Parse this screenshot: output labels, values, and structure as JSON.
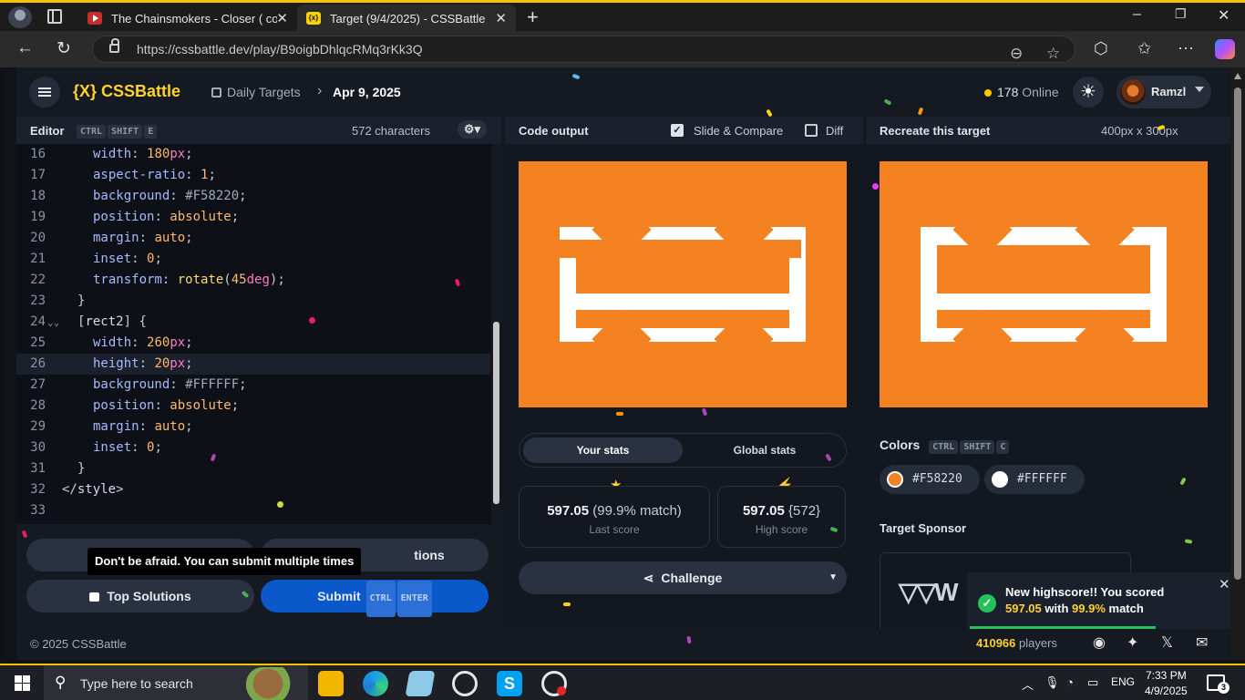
{
  "browser": {
    "tabs": [
      {
        "title": "The Chainsmokers - Closer ( cover"
      },
      {
        "title": "Target (9/4/2025) - CSSBattle",
        "favicon_text": "{x}"
      }
    ],
    "url": "https://cssbattle.dev/play/B9oigbDhlqcRMq3rKk3Q",
    "new_tab_symbol": "+",
    "window_controls": [
      "–",
      "❐",
      "✕"
    ]
  },
  "header": {
    "logo_mark": "{X}",
    "logo_text": "CSSBattle",
    "crumb_section": "Daily Targets",
    "crumb_separator": "›",
    "crumb_date": "Apr 9, 2025",
    "online_count": "178",
    "online_label": "Online",
    "user_name": "Ramzl"
  },
  "editor": {
    "title": "Editor",
    "shortcut": [
      "CTRL",
      "SHIFT",
      "E"
    ],
    "char_count": "572 characters",
    "lines": [
      {
        "n": "16",
        "tokens": [
          [
            "prop",
            "width"
          ],
          [
            "p",
            ": "
          ],
          [
            "num",
            "180"
          ],
          [
            "unit",
            "px"
          ],
          [
            "p",
            ";"
          ]
        ]
      },
      {
        "n": "17",
        "tokens": [
          [
            "prop",
            "aspect-ratio"
          ],
          [
            "p",
            ": "
          ],
          [
            "num",
            "1"
          ],
          [
            "p",
            ";"
          ]
        ]
      },
      {
        "n": "18",
        "tokens": [
          [
            "prop",
            "background"
          ],
          [
            "p",
            ": "
          ],
          [
            "hex",
            "#F58220"
          ],
          [
            "p",
            ";"
          ]
        ]
      },
      {
        "n": "19",
        "tokens": [
          [
            "prop",
            "position"
          ],
          [
            "p",
            ": "
          ],
          [
            "num",
            "absolute"
          ],
          [
            "p",
            ";"
          ]
        ]
      },
      {
        "n": "20",
        "tokens": [
          [
            "prop",
            "margin"
          ],
          [
            "p",
            ": "
          ],
          [
            "num",
            "auto"
          ],
          [
            "p",
            ";"
          ]
        ]
      },
      {
        "n": "21",
        "tokens": [
          [
            "prop",
            "inset"
          ],
          [
            "p",
            ": "
          ],
          [
            "num",
            "0"
          ],
          [
            "p",
            ";"
          ]
        ]
      },
      {
        "n": "22",
        "tokens": [
          [
            "prop",
            "transform"
          ],
          [
            "p",
            ": "
          ],
          [
            "fn",
            "rotate"
          ],
          [
            "p",
            "("
          ],
          [
            "num",
            "45"
          ],
          [
            "unit",
            "deg"
          ],
          [
            "p",
            ");"
          ]
        ]
      },
      {
        "n": "23",
        "tokens": [
          [
            "p",
            "}"
          ]
        ],
        "indent": 1
      },
      {
        "n": "24",
        "tokens": [
          [
            "p",
            "["
          ],
          [
            "tag",
            "rect2"
          ],
          [
            "p",
            "] {"
          ]
        ],
        "indent": 1,
        "fold": "⌄⌄"
      },
      {
        "n": "25",
        "tokens": [
          [
            "prop",
            "width"
          ],
          [
            "p",
            ": "
          ],
          [
            "num",
            "260"
          ],
          [
            "unit",
            "px"
          ],
          [
            "p",
            ";"
          ]
        ]
      },
      {
        "n": "26",
        "tokens": [
          [
            "prop",
            "height"
          ],
          [
            "p",
            ": "
          ],
          [
            "num",
            "20"
          ],
          [
            "unit",
            "px"
          ],
          [
            "p",
            ";"
          ]
        ],
        "active": true
      },
      {
        "n": "27",
        "tokens": [
          [
            "prop",
            "background"
          ],
          [
            "p",
            ": "
          ],
          [
            "hex",
            "#FFFFFF"
          ],
          [
            "p",
            ";"
          ]
        ]
      },
      {
        "n": "28",
        "tokens": [
          [
            "prop",
            "position"
          ],
          [
            "p",
            ": "
          ],
          [
            "num",
            "absolute"
          ],
          [
            "p",
            ";"
          ]
        ]
      },
      {
        "n": "29",
        "tokens": [
          [
            "prop",
            "margin"
          ],
          [
            "p",
            ": "
          ],
          [
            "num",
            "auto"
          ],
          [
            "p",
            ";"
          ]
        ]
      },
      {
        "n": "30",
        "tokens": [
          [
            "prop",
            "inset"
          ],
          [
            "p",
            ": "
          ],
          [
            "num",
            "0"
          ],
          [
            "p",
            ";"
          ]
        ]
      },
      {
        "n": "31",
        "tokens": [
          [
            "p",
            "}"
          ]
        ],
        "indent": 1
      },
      {
        "n": "32",
        "tokens": [
          [
            "p",
            "</"
          ],
          [
            "tag",
            "style"
          ],
          [
            "p",
            ">"
          ]
        ],
        "indent": 0
      },
      {
        "n": "33",
        "tokens": [],
        "indent": 0
      }
    ],
    "tooltip": "Don't be afraid. You can submit multiple times",
    "solutions_btn_tail": "tions",
    "top_solutions": "Top Solutions",
    "submit": "Submit",
    "submit_keys": [
      "CTRL",
      "ENTER"
    ]
  },
  "output": {
    "title": "Code output",
    "slide_compare": "Slide & Compare",
    "slide_compare_checked": true,
    "diff": "Diff",
    "diff_checked": false,
    "tab_your": "Your stats",
    "tab_global": "Global stats",
    "last_score": "597.05",
    "last_match": "(99.9% match)",
    "last_label": "Last score",
    "high_score": "597.05",
    "high_chars": "{572}",
    "high_label": "High score",
    "challenge": "Challenge"
  },
  "target": {
    "title": "Recreate this target",
    "size": "400px x 300px",
    "colors_label": "Colors",
    "colors_keys": [
      "CTRL",
      "SHIFT",
      "C"
    ],
    "colors": [
      {
        "hex": "#F58220",
        "swatch": "#f58220"
      },
      {
        "hex": "#FFFFFF",
        "swatch": "#ffffff"
      }
    ],
    "sponsor_label": "Target Sponsor",
    "sponsor_logo": "W"
  },
  "toast": {
    "line1": "New highscore!! You scored",
    "score": "597.05",
    "with": "with",
    "match": "99.9%",
    "match_word": "match",
    "progress": 0.7
  },
  "footer": {
    "copyright": "© 2025 CSSBattle",
    "players_count": "410966",
    "players_label": "players"
  },
  "taskbar": {
    "search_placeholder": "Type here to search",
    "language": "ENG",
    "time": "7:33 PM",
    "date": "4/9/2025",
    "notification_count": "3"
  },
  "colors": {
    "accent": "#ffd22e",
    "target_bg": "#f58220",
    "submit_bg": "#0a58ca",
    "success": "#25c25a"
  }
}
